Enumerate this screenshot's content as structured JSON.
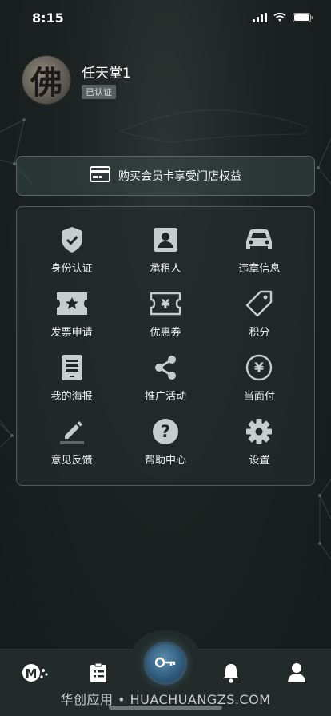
{
  "status_bar": {
    "time": "8:15"
  },
  "profile": {
    "name": "任天堂1",
    "badge": "已认证",
    "avatar_glyph": "佛"
  },
  "member_banner": {
    "label": "购买会员卡享受门店权益",
    "icon": "card-icon"
  },
  "menu": [
    {
      "label": "身份认证",
      "icon": "shield-check-icon"
    },
    {
      "label": "承租人",
      "icon": "person-badge-icon"
    },
    {
      "label": "违章信息",
      "icon": "car-icon"
    },
    {
      "label": "发票申请",
      "icon": "ticket-star-icon"
    },
    {
      "label": "优惠券",
      "icon": "coupon-yen-icon"
    },
    {
      "label": "积分",
      "icon": "tag-icon"
    },
    {
      "label": "我的海报",
      "icon": "tablet-icon"
    },
    {
      "label": "推广活动",
      "icon": "share-icon"
    },
    {
      "label": "当面付",
      "icon": "yen-circle-icon"
    },
    {
      "label": "意见反馈",
      "icon": "pencil-icon"
    },
    {
      "label": "帮助中心",
      "icon": "question-circle-icon"
    },
    {
      "label": "设置",
      "icon": "gear-icon"
    }
  ],
  "tab_bar": {
    "tabs": [
      "logo-icon",
      "clipboard-icon",
      "key-icon",
      "bell-icon",
      "person-icon"
    ],
    "watermark": "华创应用 • HUACHUANGZS.COM"
  }
}
